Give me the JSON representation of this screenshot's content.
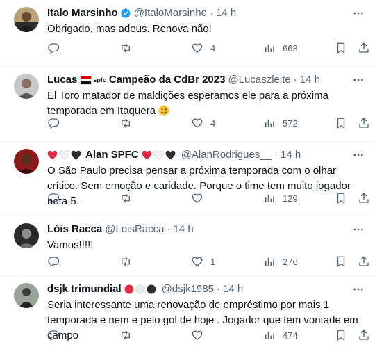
{
  "tweets": [
    {
      "name": "Italo Marsinho",
      "verified": true,
      "handle": "@ItaloMarsinho",
      "time": "14 h",
      "text": "Obrigado, mas adeus. Renova não!",
      "stats": {
        "replies": "",
        "retweets": "",
        "likes": "4",
        "views": "663"
      }
    },
    {
      "name": "Lucas",
      "badge_text": "spfc",
      "name_suffix": "Campeão da CdBr 2023",
      "handle": "@Lucaszleite",
      "time": "14 h",
      "text": "El Toro matador de maldições esperamos ele para a próxima temporada em Itaquera",
      "emoji": "winking-face-emoji",
      "stats": {
        "replies": "",
        "retweets": "",
        "likes": "4",
        "views": "572"
      }
    },
    {
      "name": "Alan SPFC",
      "name_glyphs": [
        "red-heart-icon",
        "white-heart-icon",
        "black-heart-icon"
      ],
      "handle": "@AlanRodrigues__",
      "time": "14 h",
      "text": "O São Paulo precisa pensar a próxima temporada com o olhar crítico. Sem emoção e caridade. Porque o time tem muito jogador nota 5.",
      "stats": {
        "replies": "",
        "retweets": "",
        "likes": "",
        "views": "129"
      }
    },
    {
      "name": "Lóis Racca",
      "handle": "@LoisRacca",
      "time": "14 h",
      "text": "Vamos!!!!!",
      "stats": {
        "replies": "",
        "retweets": "",
        "likes": "1",
        "views": "276"
      }
    },
    {
      "name": "dsjk trimundial",
      "name_glyphs": [
        "red-circle-icon",
        "white-circle-icon",
        "black-circle-icon"
      ],
      "handle": "@dsjk1985",
      "time": "14 h",
      "text": "Seria interessante uma renovação de empréstimo por mais 1 temporada e nem e pelo gol de hoje . Jogador que tem vontade em campo",
      "stats": {
        "replies": "",
        "retweets": "",
        "likes": "",
        "views": "474"
      }
    }
  ],
  "colors": {
    "text": "#0f1419",
    "secondary": "#536471",
    "verified": "#1d9bf0",
    "divider": "#eff3f4",
    "spfc_red": "#d10000"
  }
}
